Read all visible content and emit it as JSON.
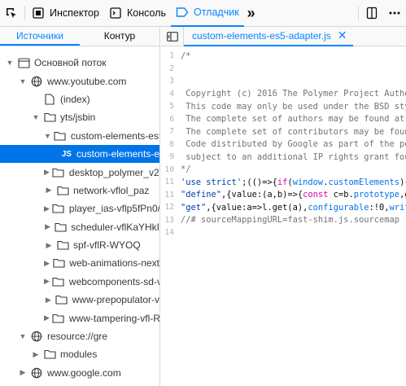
{
  "toolbar": {
    "inspector_label": "Инспектор",
    "console_label": "Консоль",
    "debugger_label": "Отладчик",
    "more_label": "»"
  },
  "sources_panel": {
    "tabs": [
      "Источники",
      "Контур"
    ],
    "tree": [
      {
        "label": "Основной поток",
        "type": "thread",
        "depth": 0,
        "expanded": true
      },
      {
        "label": "www.youtube.com",
        "type": "domain",
        "depth": 1,
        "expanded": true
      },
      {
        "label": "(index)",
        "type": "file",
        "depth": 2
      },
      {
        "label": "yts/jsbin",
        "type": "folder",
        "depth": 2,
        "expanded": true
      },
      {
        "label": "custom-elements-es5",
        "type": "folder",
        "depth": 3,
        "expanded": true
      },
      {
        "label": "custom-elements-e",
        "type": "js",
        "depth": 4,
        "selected": true
      },
      {
        "label": "desktop_polymer_v2-",
        "type": "folder",
        "depth": 3
      },
      {
        "label": "network-vflol_paz",
        "type": "folder",
        "depth": 3
      },
      {
        "label": "player_ias-vflp5fPn0/r",
        "type": "folder",
        "depth": 3
      },
      {
        "label": "scheduler-vflKaYHkI",
        "type": "folder",
        "depth": 3
      },
      {
        "label": "spf-vflR-WYOQ",
        "type": "folder",
        "depth": 3
      },
      {
        "label": "web-animations-next",
        "type": "folder",
        "depth": 3
      },
      {
        "label": "webcomponents-sd-v",
        "type": "folder",
        "depth": 3
      },
      {
        "label": "www-prepopulator-v",
        "type": "folder",
        "depth": 3
      },
      {
        "label": "www-tampering-vfl-R",
        "type": "folder",
        "depth": 3
      },
      {
        "label": "resource://gre",
        "type": "domain",
        "depth": 1,
        "expanded": true
      },
      {
        "label": "modules",
        "type": "folder",
        "depth": 2
      },
      {
        "label": "www.google.com",
        "type": "domain",
        "depth": 1
      }
    ]
  },
  "editor": {
    "tab_label": "custom-elements-es5-adapter.js",
    "close_glyph": "✕",
    "lines": [
      {
        "n": "1",
        "text": "/*"
      },
      {
        "n": "2",
        "text": ""
      },
      {
        "n": "3",
        "text": ""
      },
      {
        "n": "4",
        "text": " Copyright (c) 2016 The Polymer Project Autho"
      },
      {
        "n": "5",
        "text": " This code may only be used under the BSD sty"
      },
      {
        "n": "6",
        "text": " The complete set of authors may be found at "
      },
      {
        "n": "7",
        "text": " The complete set of contributors may be foun"
      },
      {
        "n": "8",
        "text": " Code distributed by Google as part of the po"
      },
      {
        "n": "9",
        "text": " subject to an additional IP rights grant fou"
      },
      {
        "n": "10",
        "text": "*/"
      },
      {
        "n": "11",
        "text": "'use strict';(()=>{if(window.customElements){"
      },
      {
        "n": "11",
        "text": "\"define\",{value:(a,b)=>{const c=b.prototype,g"
      },
      {
        "n": "12",
        "text": "\"get\",{value:a=>l.get(a),configurable:!0,writ"
      },
      {
        "n": "13",
        "text": "//# sourceMappingURL=fast-shim.js.sourcemap"
      },
      {
        "n": "14",
        "text": ""
      }
    ]
  }
}
